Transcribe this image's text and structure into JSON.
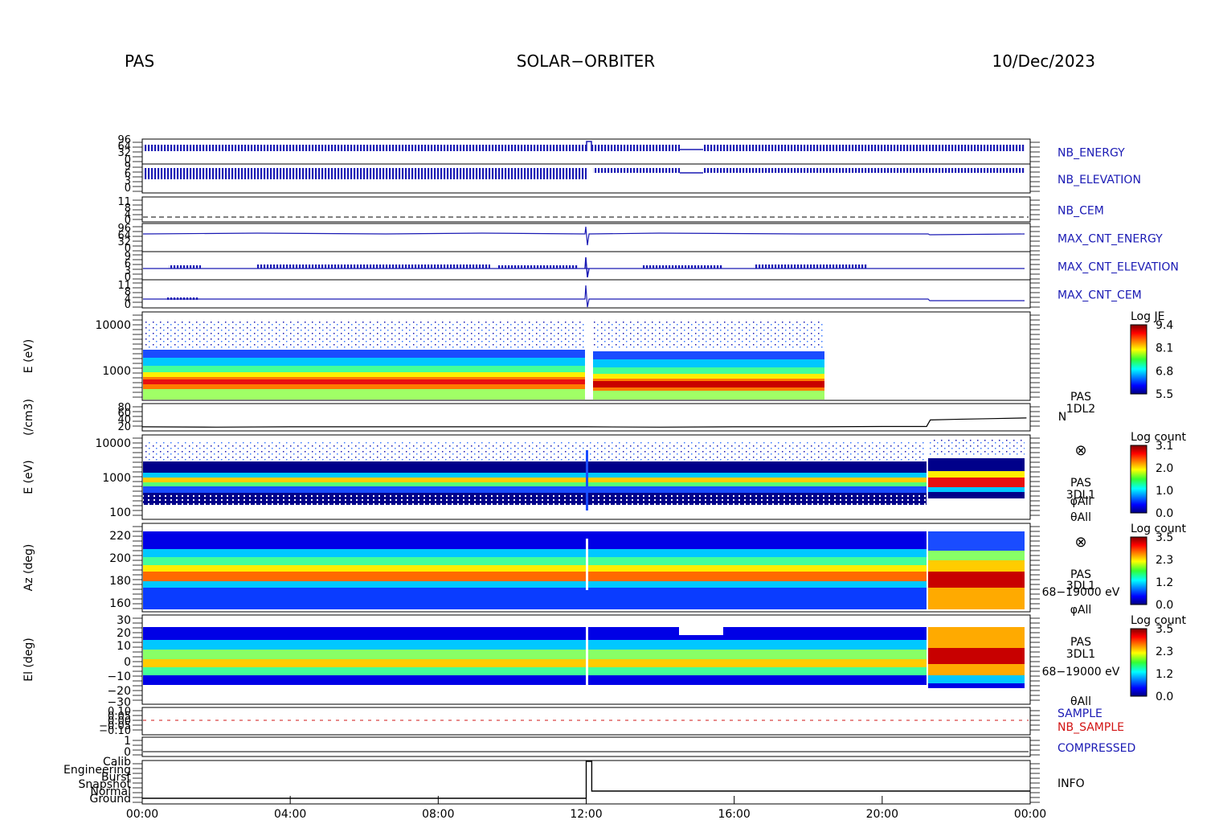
{
  "header": {
    "left": "PAS",
    "center": "SOLAR−ORBITER",
    "right": "10/Dec/2023"
  },
  "time_axis": {
    "ticks": [
      "00:00",
      "04:00",
      "08:00",
      "12:00",
      "16:00",
      "20:00",
      "00:00"
    ]
  },
  "colors": {
    "blue_label": "#1a1ab4",
    "red_label": "#d21414",
    "frame": "#000000"
  },
  "chart_data": [
    {
      "type": "line",
      "panel": "nb_energy",
      "label": "NB_ENERGY",
      "ytick_labels": [
        "96",
        "64",
        "32",
        "0"
      ],
      "segments": [
        {
          "x": [
            0.0,
            12.0
          ],
          "pattern": "dense-ticks"
        },
        {
          "x": [
            12.0,
            12.2
          ],
          "pattern": "step-high"
        },
        {
          "x": [
            12.2,
            14.6
          ],
          "pattern": "dense-ticks"
        },
        {
          "x": [
            14.6,
            15.2
          ],
          "pattern": "flat"
        },
        {
          "x": [
            15.2,
            23.9
          ],
          "pattern": "dense-ticks"
        }
      ]
    },
    {
      "type": "line",
      "panel": "nb_elevation",
      "label": "NB_ELEVATION",
      "ytick_labels": [
        "9",
        "6",
        "3",
        "0"
      ],
      "segments": [
        {
          "x": [
            0.0,
            12.0
          ],
          "pattern": "dense-ticks"
        },
        {
          "x": [
            12.2,
            14.6
          ],
          "pattern": "dense-ticks"
        },
        {
          "x": [
            14.6,
            15.2
          ],
          "pattern": "flat"
        },
        {
          "x": [
            15.2,
            23.9
          ],
          "pattern": "dense-ticks"
        }
      ]
    },
    {
      "type": "line",
      "panel": "nb_cem",
      "label": "NB_CEM",
      "ytick_labels": [
        "11",
        "8",
        "4",
        "0"
      ]
    },
    {
      "type": "line",
      "panel": "max_cnt_energy",
      "label": "MAX_CNT_ENERGY",
      "ytick_labels": [
        "96",
        "64",
        "32",
        "0"
      ]
    },
    {
      "type": "line",
      "panel": "max_cnt_elevation",
      "label": "MAX_CNT_ELEVATION",
      "ytick_labels": [
        "9",
        "6",
        "3",
        "0"
      ]
    },
    {
      "type": "line",
      "panel": "max_cnt_cem",
      "label": "MAX_CNT_CEM",
      "ytick_labels": [
        "11",
        "8",
        "4",
        "0"
      ]
    },
    {
      "type": "heatmap",
      "panel": "energy_spectrogram_l2",
      "ylabel": "E (eV)",
      "yscale": "log",
      "ytick_labels": [
        "10000",
        "1000"
      ],
      "data_extent_hours": [
        0.0,
        18.5
      ],
      "colorbar": {
        "title": "Log JE",
        "ticks": [
          "9.4",
          "8.1",
          "6.8",
          "5.5"
        ]
      }
    },
    {
      "type": "line",
      "panel": "density",
      "ylabel": "(/cm3)",
      "ytick_labels": [
        "80",
        "60",
        "40",
        "20"
      ],
      "side_labels": [
        "PAS",
        "1DL2",
        "N"
      ],
      "x": [
        0,
        2,
        4,
        6,
        8,
        10,
        12,
        14,
        16,
        18,
        20,
        21.2,
        21.3,
        22,
        23,
        23.9
      ],
      "y": [
        22,
        21,
        22,
        22,
        22,
        22,
        22,
        21,
        22,
        22,
        23,
        23,
        42,
        44,
        46,
        48
      ]
    },
    {
      "type": "heatmap",
      "panel": "energy_spectrogram_3dl1",
      "ylabel": "E (eV)",
      "yscale": "log",
      "ytick_labels": [
        "10000",
        "1000",
        "100"
      ],
      "side_labels": [
        "⊗",
        "PAS",
        "3DL1",
        "φAll",
        "θAll"
      ],
      "colorbar": {
        "title": "Log count",
        "ticks": [
          "3.1",
          "2.0",
          "1.0",
          "0.0"
        ]
      }
    },
    {
      "type": "heatmap",
      "panel": "azimuth",
      "ylabel": "Az (deg)",
      "ytick_labels": [
        "220",
        "200",
        "180",
        "160"
      ],
      "side_labels": [
        "⊗",
        "PAS",
        "3DL1",
        "68−19000 eV",
        "φAll"
      ],
      "colorbar": {
        "title": "Log count",
        "ticks": [
          "3.5",
          "2.3",
          "1.2",
          "0.0"
        ]
      }
    },
    {
      "type": "heatmap",
      "panel": "elevation",
      "ylabel": "El (deg)",
      "ytick_labels": [
        "30",
        "20",
        "10",
        "0",
        "−10",
        "−20",
        "−30"
      ],
      "side_labels": [
        "PAS",
        "3DL1",
        "68−19000 eV",
        "θAll"
      ],
      "colorbar": {
        "title": "Log count",
        "ticks": [
          "3.5",
          "2.3",
          "1.2",
          "0.0"
        ]
      }
    },
    {
      "type": "line",
      "panel": "sample",
      "labels": [
        "SAMPLE",
        "NB_SAMPLE"
      ],
      "ytick_labels": [
        "0.10",
        "0.05",
        "0.00",
        "−0.05",
        "−0.10"
      ]
    },
    {
      "type": "line",
      "panel": "compressed",
      "label": "COMPRESSED",
      "ytick_labels": [
        "1",
        "0"
      ]
    },
    {
      "type": "line",
      "panel": "info",
      "label": "INFO",
      "ytick_labels": [
        "Calib",
        "Engineering",
        "Burst",
        "Snapshot",
        "Normal",
        "Ground"
      ],
      "x": [
        0,
        12.0,
        12.0,
        12.15,
        12.15,
        24
      ],
      "y": [
        "Ground",
        "Ground",
        "Calib",
        "Calib",
        "Normal",
        "Normal"
      ]
    }
  ]
}
